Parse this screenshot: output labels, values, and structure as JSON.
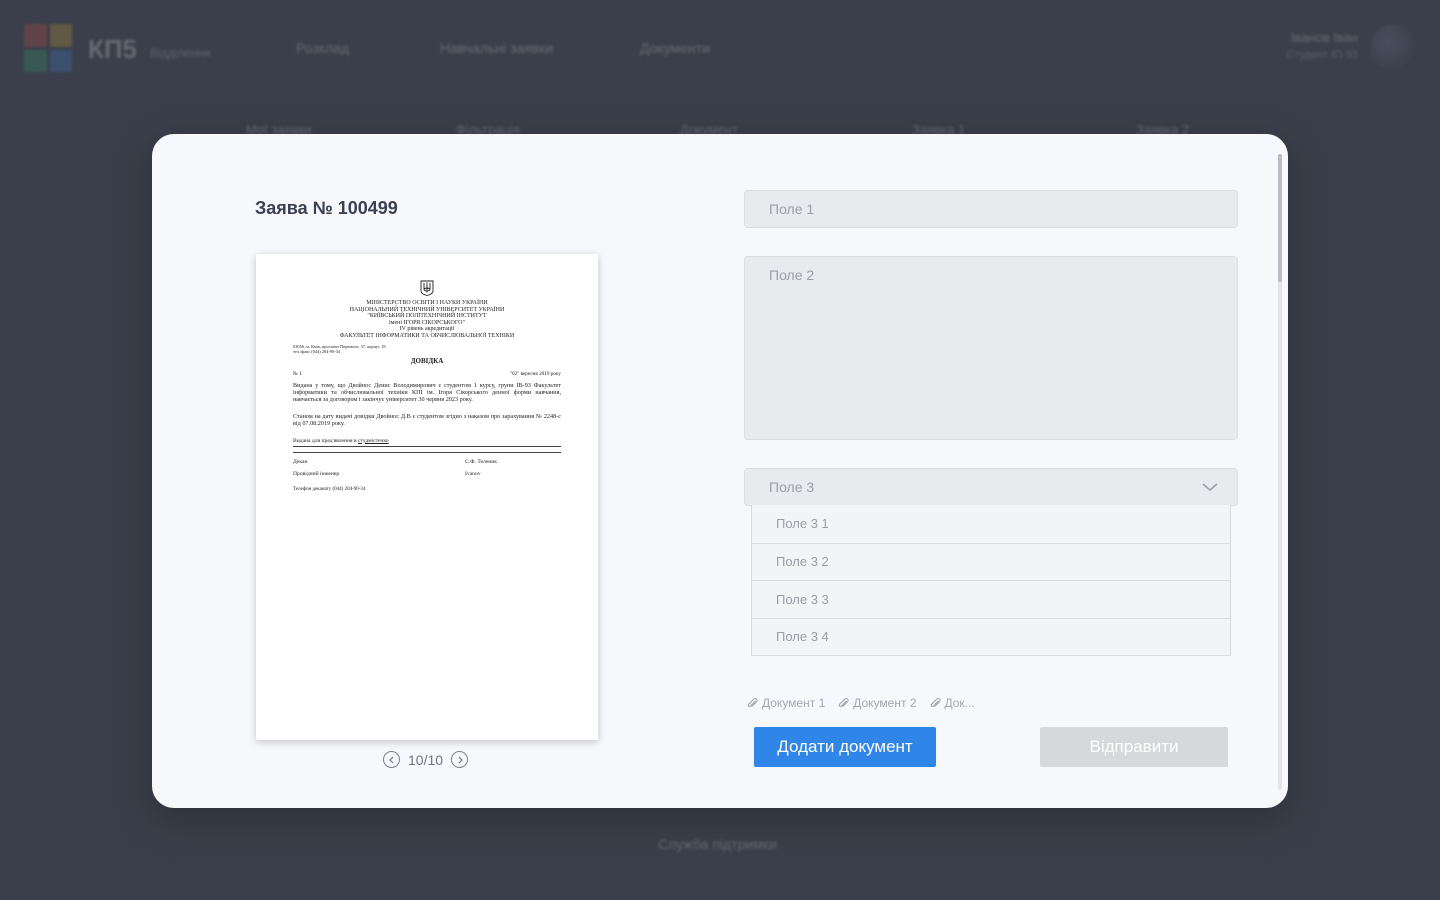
{
  "background": {
    "brand": "КП5",
    "brand_sub": "Відділення",
    "nav": [
      "Розклад",
      "Навчальні заявки",
      "Документи"
    ],
    "user_name": "Іванов Іван",
    "user_role": "Студент ІП-93",
    "columns": [
      "Мої заявки",
      "Фільтрація",
      "Документ",
      "Заявка 1",
      "Заявка 2"
    ],
    "footer": "Служба підтримки"
  },
  "modal": {
    "title": "Заява № 100499",
    "document": {
      "header_lines": [
        "МІНІСТЕРСТВО ОСВІТИ І НАУКИ УКРАЇНИ",
        "НАЦІОНАЛЬНИЙ ТЕХНІЧНИЙ УНІВЕРСИТЕТ УКРАЇНИ",
        "\"КИЇВСЬКИЙ ПОЛІТЕХНІЧНИЙ ІНСТИТУТ",
        "імені ІГОРЯ СІКОРСЬКОГО\"",
        "IV рівень акредитації",
        "ФАКУЛЬТЕТ ІНФОРМАТИКИ ТА ОБЧИСЛЮВАЛЬНОЇ ТЕХНІКИ"
      ],
      "address_1": "03056, м. Київ, проспект Перемоги, 37, корпус 18",
      "address_2": "тел./факс (044) 204-90-34",
      "heading": "ДОВІДКА",
      "number": "№ 1",
      "date": "\"02\" вересня 2019 року",
      "paragraph_1": "Видана у тому, що Двойнос Денис Володимирович є студентом 1 курсу, групи ІВ-93 Факультет інформатики та обчислювальної техніки КПІ ім. Ігоря Сікорського денної форми навчання, навчається за договором і закінчує університет 30 червня 2023 року.",
      "paragraph_2": "Станом на дату видачі довідки Двойнос Д.В є студентом згідно з наказом про зарахування № 2248-с від 07.08.2019 року.",
      "presented_label": "Видана для пред'явлення в",
      "presented_value": "студмістечко",
      "sign_1_role": "Декан",
      "sign_1_name": "С.Ф. Теленик",
      "sign_2_role": "Провідний інженер",
      "sign_2_name": "Ivanov",
      "phone": "Телефон деканату  (044) 204-90-34"
    },
    "pager": {
      "current": "10/10"
    },
    "fields": {
      "field1_placeholder": "Поле 1",
      "field2_placeholder": "Поле 2",
      "field3_value": "Поле 3",
      "field3_options": [
        "Поле 3 1",
        "Поле 3 2",
        "Поле 3 3",
        "Поле 3 4"
      ]
    },
    "attachments": [
      "Документ 1",
      "Документ 2",
      "Док..."
    ],
    "add_button": "Додати документ",
    "send_button": "Відправити"
  },
  "colors": {
    "overlay": "#3a3f4b",
    "modal_bg": "#f7f8fb",
    "primary": "#2f86e8",
    "disabled": "#d7d8db"
  }
}
